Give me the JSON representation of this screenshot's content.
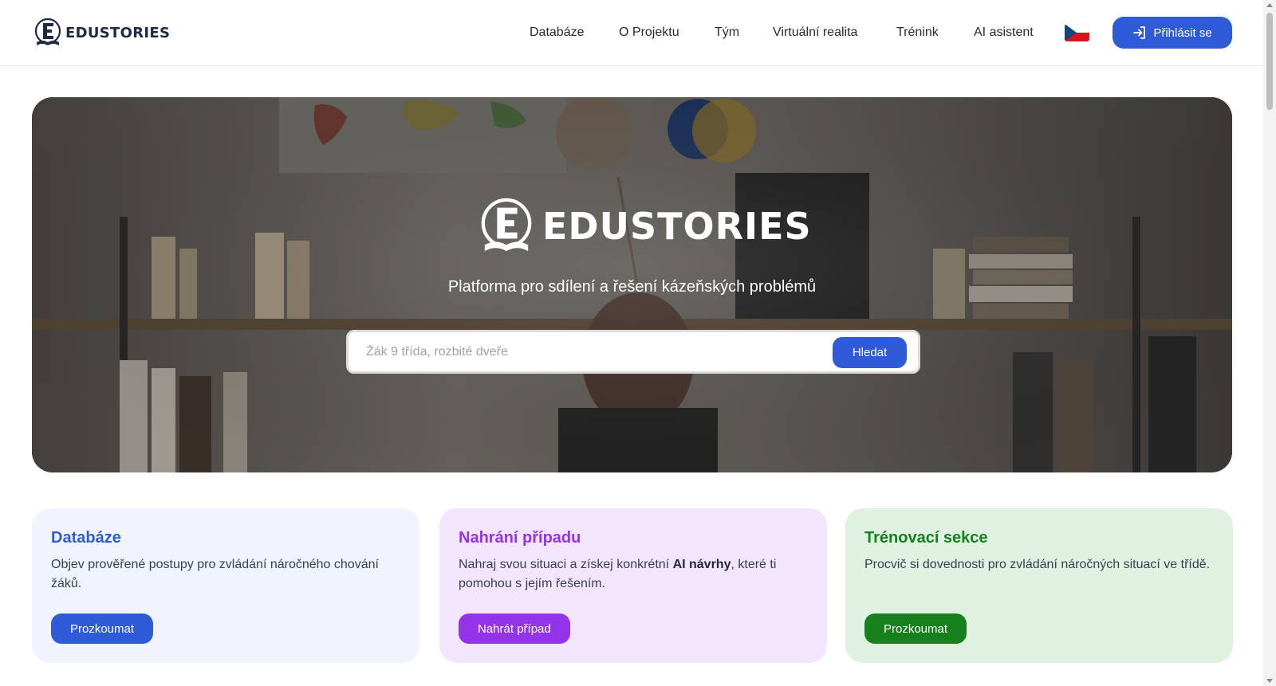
{
  "header": {
    "brand": "EDUSTORIES",
    "nav": [
      "Databáze",
      "O Projektu",
      "Tým",
      "Virtuální realita",
      "Trénink",
      "AI asistent"
    ],
    "language_flag": "cz-flag-icon",
    "login_label": "Přihlásit se",
    "login_icon": "login-icon"
  },
  "hero": {
    "logo_text": "EDUSTORIES",
    "tagline": "Platforma pro sdílení a řešení kázeňských problémů",
    "search": {
      "placeholder": "Žák 9 třída, rozbité dveře",
      "value": "",
      "button_label": "Hledat"
    }
  },
  "cards": [
    {
      "title": "Databáze",
      "description": "Objev prověřené postupy pro zvládání náročného chování žáků.",
      "button_label": "Prozkoumat",
      "accent": "#2f5bd9",
      "background": "#eff4fe"
    },
    {
      "title": "Nahrání případu",
      "description_before": "Nahraj svou situaci a získej konkrétní ",
      "description_bold": "AI návrhy",
      "description_after": ", které ti pomohou s jejím řešením.",
      "button_label": "Nahrát případ",
      "accent": "#9333ea",
      "background": "#f3e5fd"
    },
    {
      "title": "Trénovací sekce",
      "description": "Procvič si dovednosti pro zvládání náročných situací ve třídě.",
      "button_label": "Prozkoumat",
      "accent": "#16801d",
      "background": "#dff1e1"
    }
  ],
  "colors": {
    "primary": "#2f5bd9",
    "purple": "#9333ea",
    "green": "#16801d",
    "text": "#1f2937"
  }
}
